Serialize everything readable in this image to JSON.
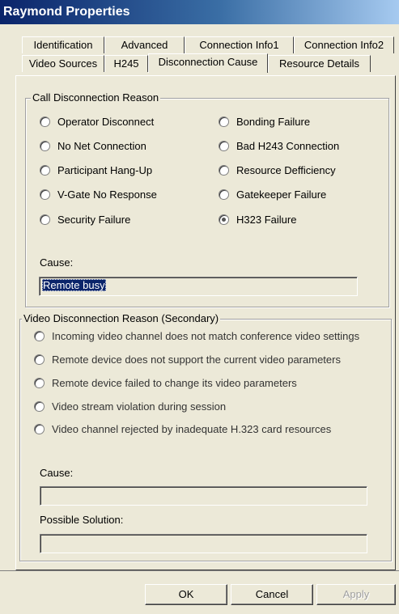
{
  "window": {
    "title": "Raymond Properties"
  },
  "tabs": {
    "row_back": [
      "Identification",
      "Advanced",
      "Connection Info1",
      "Connection Info2"
    ],
    "row_front": [
      "Video Sources",
      "H245",
      "Disconnection Cause",
      "Resource Details"
    ],
    "active": "Disconnection Cause"
  },
  "call_group": {
    "legend": "Call Disconnection Reason",
    "left_options": [
      "Operator Disconnect",
      "No Net Connection",
      "Participant Hang-Up",
      "V-Gate No Response",
      "Security Failure"
    ],
    "right_options": [
      "Bonding Failure",
      "Bad H243 Connection",
      "Resource Defficiency",
      "Gatekeeper Failure",
      "H323 Failure"
    ],
    "selected": "H323 Failure",
    "cause_label": "Cause:",
    "cause_value": "Remote busy"
  },
  "video_group": {
    "legend": "Video Disconnection Reason (Secondary)",
    "options": [
      "Incoming video channel does not match conference video settings",
      "Remote device does not support the current video parameters",
      "Remote device failed to change its video parameters",
      "Video stream violation during session",
      "Video channel rejected by inadequate H.323 card resources"
    ],
    "cause_label": "Cause:",
    "cause_value": "",
    "solution_label": "Possible Solution:",
    "solution_value": ""
  },
  "buttons": {
    "ok": "OK",
    "cancel": "Cancel",
    "apply": "Apply"
  }
}
